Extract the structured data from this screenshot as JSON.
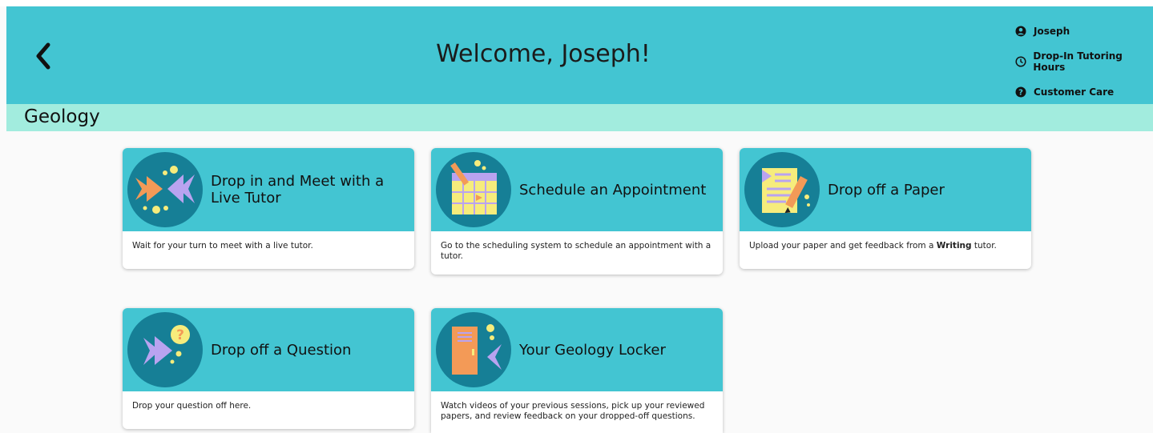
{
  "header": {
    "title": "Welcome, Joseph!",
    "menu": {
      "user": "Joseph",
      "hours": "Drop-In Tutoring Hours",
      "care": "Customer Care"
    }
  },
  "subject": "Geology",
  "cards": [
    {
      "title": "Drop in and Meet with a Live Tutor",
      "desc": "Wait for your turn to meet with a live tutor."
    },
    {
      "title": "Schedule an Appointment",
      "desc": "Go to the scheduling system to schedule an appointment with a tutor."
    },
    {
      "title": "Drop off a Paper",
      "desc_pre": "Upload your paper and get feedback from a ",
      "desc_bold": "Writing",
      "desc_post": " tutor."
    },
    {
      "title": "Drop off a Question",
      "desc": "Drop your question off here."
    },
    {
      "title": "Your Geology Locker",
      "desc": "Watch videos of your previous sessions, pick up your reviewed papers, and review feedback on your dropped-off questions."
    }
  ],
  "colors": {
    "header": "#43c5d2",
    "subject_bar": "#a2ecde",
    "icon_circle": "#167f96"
  }
}
